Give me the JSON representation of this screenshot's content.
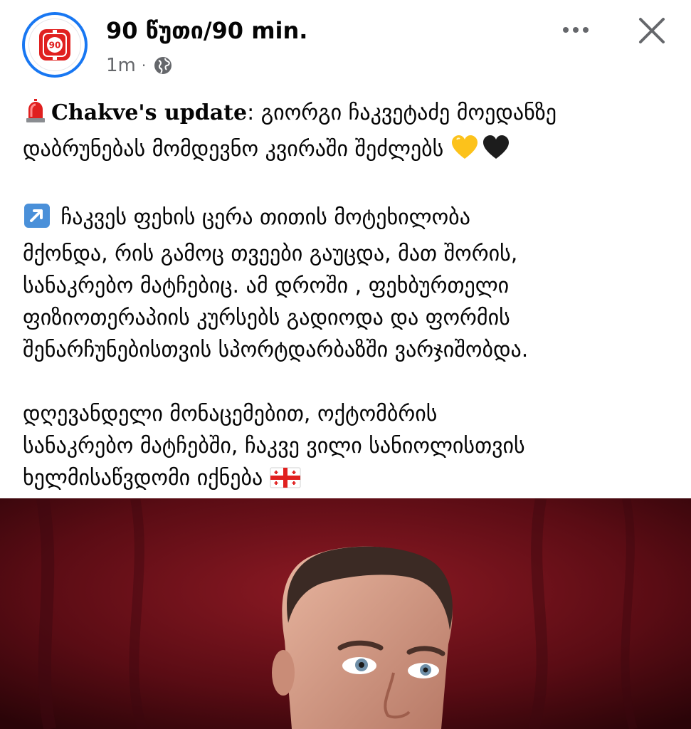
{
  "header": {
    "page_name": "90 წუთი/90 min.",
    "time": "1m",
    "dot": "·",
    "avatar_logo_text": "90",
    "brand_color": "#1877f2"
  },
  "icons": {
    "more": "more-options-icon",
    "close": "close-icon",
    "audience": "globe-icon",
    "siren": "siren-emoji-icon",
    "arrow": "up-right-arrow-emoji-icon",
    "hearts": [
      "yellow-heart-icon",
      "black-heart-icon"
    ],
    "flag": "georgia-flag-icon"
  },
  "post": {
    "p1": {
      "bold": "Chakve's update",
      "line1_rest": ": გიორგი ჩაკვეტაძე მოედანზე",
      "line2": "დაბრუნებას მომდევნო კვირაში შეძლებს"
    },
    "p2": {
      "line1": "ჩაკვეს ფეხის ცერა თითის მოტეხილობა",
      "line2": "მქონდა, რის გამოც თვეები გაუცდა, მათ შორის,",
      "line3": "სანაკრებო მატჩებიც. ამ დროში , ფეხბურთელი",
      "line4": "ფიზიოთერაპიის კურსებს გადიოდა და ფორმის",
      "line5": "შენარჩუნებისთვის სპორტდარბაზში ვარჯიშობდა."
    },
    "p3": {
      "line1": "დღევანდელი მონაცემებით, ოქტომბრის",
      "line2": "სანაკრებო მატჩებში, ჩაკვე ვილი სანიოლისთვის",
      "line3": "ხელმისაწვდომი იქნება"
    }
  },
  "colors": {
    "text": "#050505",
    "secondary": "#65676b",
    "photo_background": "#5a0c14"
  }
}
